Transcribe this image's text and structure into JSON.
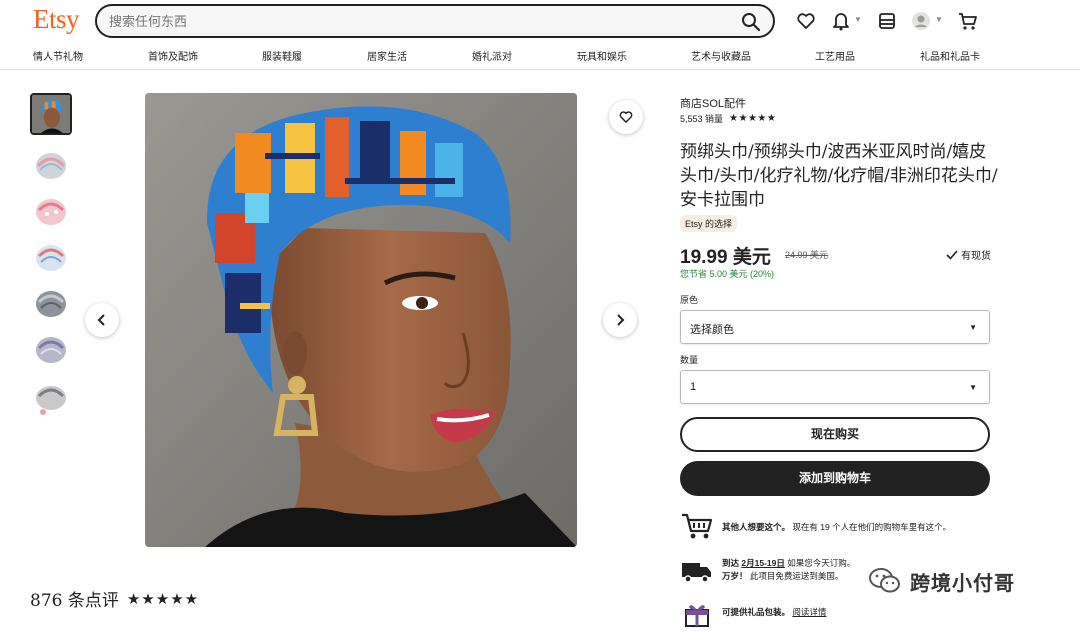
{
  "header": {
    "logo": "Etsy",
    "search_placeholder": "搜索任何东西"
  },
  "nav": {
    "items": [
      "情人节礼物",
      "首饰及配饰",
      "服装鞋履",
      "居家生活",
      "婚礼派对",
      "玩具和娱乐",
      "艺术与收藏品",
      "工艺用品",
      "礼品和礼品卡"
    ]
  },
  "product": {
    "shop_name": "商店SOL配件",
    "sales": "5,553 销量",
    "rating_stars": "★★★★★",
    "title": "预绑头巾/预绑头巾/波西米亚风时尚/嬉皮头巾/头巾/化疗礼物/化疗帽/非洲印花头巾/安卡拉围巾",
    "pick_badge": "Etsy 的选择",
    "price": "19.99 美元",
    "old_price": "24.99 美元",
    "in_stock": "有现货",
    "saving": "您节省 5.00 美元 (20%)",
    "color_label": "原色",
    "color_value": "选择颜色",
    "quantity_label": "数量",
    "quantity_value": "1",
    "buy_now": "现在购买",
    "add_to_cart": "添加到购物车"
  },
  "info": {
    "demand_bold": "其他人想要这个。",
    "demand_text": "现在有 19 个人在他们的购物车里有这个。",
    "delivery_label": "到达",
    "delivery_dates": "2月15-19日",
    "delivery_text1": "如果您今天订购。",
    "delivery_bold2": "万岁！",
    "delivery_text2": "此项目免费运送到美国。",
    "gift_text": "可提供礼品包装。",
    "gift_link": "阅读详情"
  },
  "reviews": {
    "count": "876 条点评",
    "stars": "★★★★★"
  },
  "watermark": {
    "text": "跨境小付哥"
  },
  "colors": {
    "brand": "#f1641e",
    "dark": "#222222",
    "saving": "#258635"
  }
}
